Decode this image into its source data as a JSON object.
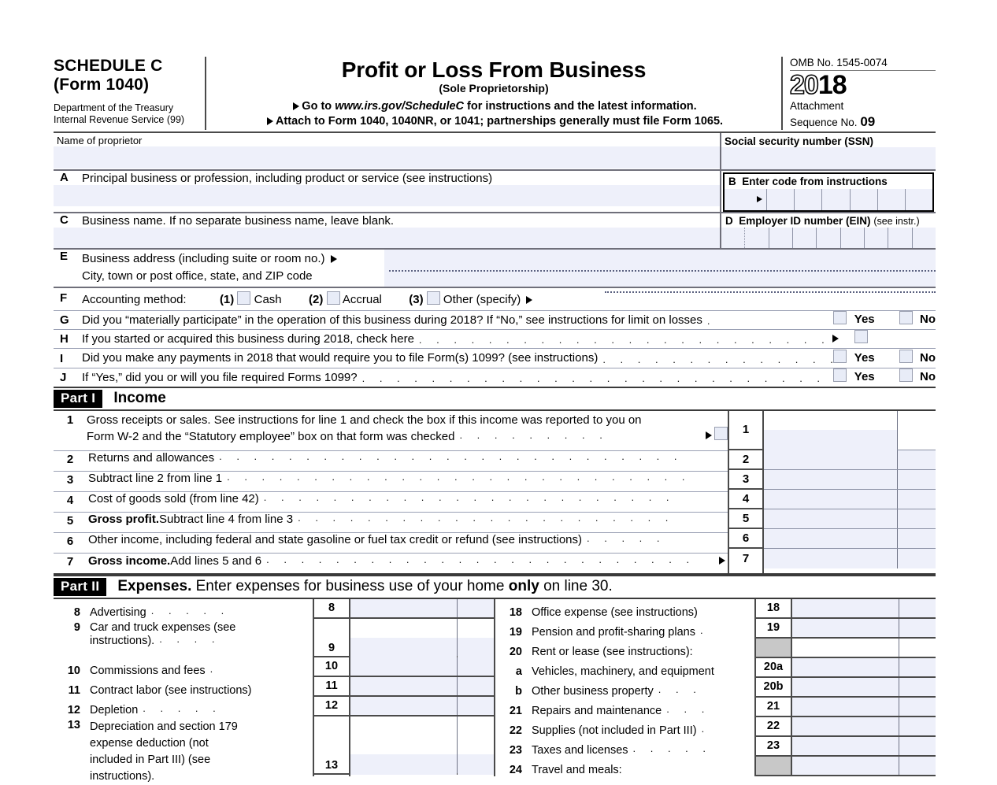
{
  "header": {
    "schedule": "SCHEDULE C",
    "form": "(Form 1040)",
    "dept_line1": "Department of the Treasury",
    "dept_line2": "Internal Revenue Service (99)",
    "title": "Profit or Loss From Business",
    "subtitle": "(Sole Proprietorship)",
    "goto_prefix": "Go to ",
    "goto_url": "www.irs.gov/ScheduleC",
    "goto_suffix": " for instructions and the latest information.",
    "attach": "Attach to Form 1040, 1040NR, or 1041; partnerships generally must file Form 1065.",
    "omb": "OMB No. 1545-0074",
    "year_hollow": "20",
    "year_solid": "18",
    "attachment_label": "Attachment",
    "sequence_label": "Sequence No. ",
    "sequence_no": "09"
  },
  "identification": {
    "name_of_proprietor": "Name of proprietor",
    "ssn_label": "Social security number (SSN)",
    "ssn_value": "",
    "name_value": "",
    "a_letter": "A",
    "a_label": "Principal business or profession, including product or service (see instructions)",
    "a_value": "",
    "b_letter": "B",
    "b_label": "Enter code from instructions",
    "b_cells": 6,
    "c_letter": "C",
    "c_label": "Business name. If no separate business name, leave blank.",
    "c_value": "",
    "d_letter": "D",
    "d_label_bold": "Employer ID number (EIN)",
    "d_label_small": "(see instr.)",
    "d_cells": 9,
    "e_letter": "E",
    "e_label": "Business address (including suite or room no.)",
    "e_value": "",
    "e_city_label": "City, town or post office, state, and ZIP code",
    "e_city_value": "",
    "f_letter": "F",
    "f_label": "Accounting method:",
    "f_options": [
      {
        "num": "(1)",
        "label": "Cash",
        "checked": false
      },
      {
        "num": "(2)",
        "label": "Accrual",
        "checked": false
      },
      {
        "num": "(3)",
        "label": "Other (specify)",
        "checked": false
      }
    ],
    "f_other_value": "",
    "g_letter": "G",
    "g_label": "Did you “materially participate” in the operation of this business during 2018? If “No,” see instructions for limit on losses",
    "g_yes": "Yes",
    "g_no": "No",
    "h_letter": "H",
    "h_label": "If you started or acquired this business during 2018, check here",
    "i_letter": "I",
    "i_label": "Did you make any payments in 2018 that would require you to file Form(s) 1099? (see instructions)",
    "i_yes": "Yes",
    "i_no": "No",
    "j_letter": "J",
    "j_label": "If “Yes,” did you or will you file required Forms 1099?",
    "j_yes": "Yes",
    "j_no": "No"
  },
  "part1": {
    "tag": "Part I",
    "title": "Income",
    "lines": [
      {
        "num": "1",
        "text_line1": "Gross receipts or sales. See instructions for line 1 and check the box if this income was reported to you on",
        "text_line2": "Form W-2 and the “Statutory employee” box on that form was checked",
        "has_checkbox": true,
        "has_arrow": true,
        "value": ""
      },
      {
        "num": "2",
        "text_line1": "Returns and allowances",
        "value": ""
      },
      {
        "num": "3",
        "text_line1": "Subtract line 2 from line 1",
        "value": ""
      },
      {
        "num": "4",
        "text_line1": "Cost of goods sold (from line 42)",
        "value": ""
      },
      {
        "num": "5",
        "bold_lead": "Gross profit.",
        "text_line1": " Subtract line 4 from line 3",
        "value": ""
      },
      {
        "num": "6",
        "text_line1": "Other income, including federal and state gasoline or fuel tax credit or refund (see instructions)",
        "value": ""
      },
      {
        "num": "7",
        "bold_lead": "Gross income.",
        "text_line1": " Add lines 5 and 6",
        "has_arrow": true,
        "value": ""
      }
    ]
  },
  "part2": {
    "tag": "Part II",
    "title_bold": "Expenses.",
    "title_rest": " Enter expenses for business use of your home ",
    "title_only": "only",
    "title_end": " on line 30.",
    "left_lines": [
      {
        "num": "8",
        "text": "Advertising",
        "dots": 5,
        "box_num": "8",
        "value": ""
      },
      {
        "num": "9",
        "text": "Car and truck expenses (see",
        "text2": "instructions).",
        "dots": 4,
        "box_num": "9",
        "value": ""
      },
      {
        "num": "10",
        "text": "Commissions and fees",
        "dots": 1,
        "box_num": "10",
        "value": ""
      },
      {
        "num": "11",
        "text": "Contract labor (see instructions)",
        "dots": 0,
        "box_num": "11",
        "value": ""
      },
      {
        "num": "12",
        "text": "Depletion",
        "dots": 5,
        "box_num": "12",
        "value": ""
      },
      {
        "num": "13",
        "text": "Depreciation and section 179",
        "text2": "expense    deduction    (not",
        "text3": "included   in   Part   III)   (see",
        "text4": "instructions).",
        "box_num": "13",
        "value": ""
      }
    ],
    "right_lines": [
      {
        "num": "18",
        "text": "Office expense (see instructions)",
        "dots": 0,
        "box_num": "18",
        "value": "",
        "shaded": false
      },
      {
        "num": "19",
        "text": "Pension and profit-sharing plans",
        "dots": 1,
        "box_num": "19",
        "value": "",
        "shaded": false
      },
      {
        "num": "20",
        "text": "Rent or lease (see instructions):",
        "dots": 0,
        "box_num": "",
        "value": "",
        "shaded": true
      },
      {
        "num": "a",
        "text": "Vehicles, machinery, and equipment",
        "dots": 0,
        "box_num": "20a",
        "value": "",
        "shaded": false
      },
      {
        "num": "b",
        "text": "Other business property",
        "dots": 3,
        "box_num": "20b",
        "value": "",
        "shaded": false
      },
      {
        "num": "21",
        "text": "Repairs and maintenance",
        "dots": 3,
        "box_num": "21",
        "value": "",
        "shaded": false
      },
      {
        "num": "22",
        "text": "Supplies (not included in Part III)",
        "dots": 1,
        "box_num": "22",
        "value": "",
        "shaded": false
      },
      {
        "num": "23",
        "text": "Taxes and licenses",
        "dots": 5,
        "box_num": "23",
        "value": "",
        "shaded": false
      },
      {
        "num": "24",
        "text": "Travel and meals:",
        "dots": 0,
        "box_num": "",
        "value": "",
        "shaded": true
      }
    ]
  },
  "colors": {
    "field_fill": "#eef0fa",
    "shaded_cell": "#c8c8c8",
    "rule": "#4a4a4a",
    "light_rule": "#9aa0b4"
  }
}
